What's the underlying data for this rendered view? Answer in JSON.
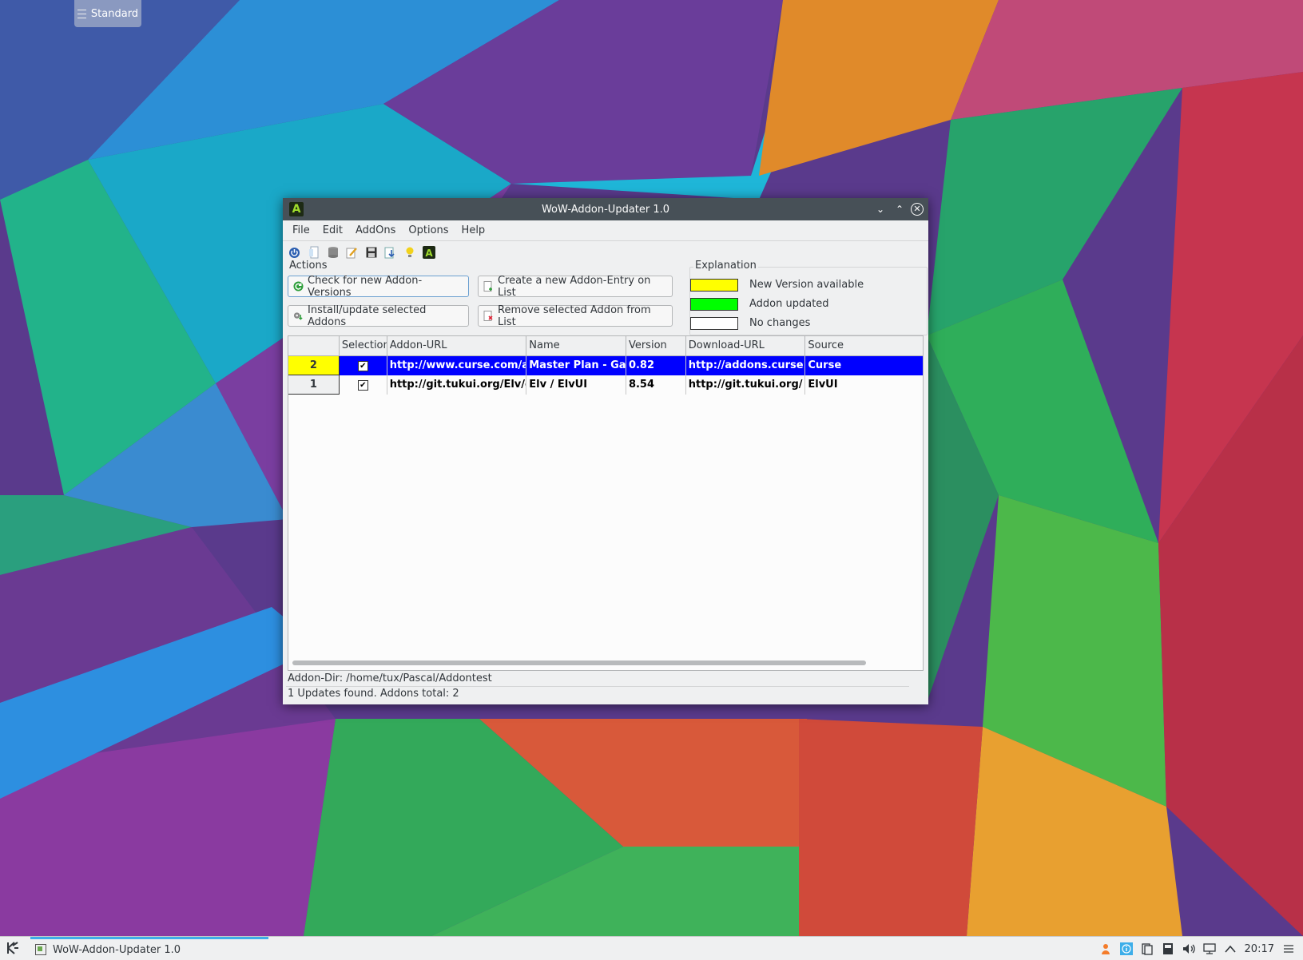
{
  "desktop": {
    "panel_label": "Standard"
  },
  "window": {
    "title": "WoW-Addon-Updater 1.0",
    "app_icon_letter": "A",
    "controls": {
      "minimize": "⌄",
      "maximize": "⌃",
      "close": "✕"
    }
  },
  "menu": [
    "File",
    "Edit",
    "AddOns",
    "Options",
    "Help"
  ],
  "toolbar": {
    "icons": [
      "power-icon",
      "page-icon",
      "database-icon",
      "edit-icon",
      "save-icon",
      "import-icon",
      "lightbulb-icon",
      "addon-logo-icon"
    ]
  },
  "actions": {
    "title": "Actions",
    "check": "Check for new Addon-Versions",
    "create": "Create a new Addon-Entry on List",
    "install": "Install/update selected Addons",
    "remove": "Remove selected Addon from List"
  },
  "explanation": {
    "title": "Explanation",
    "items": [
      {
        "label": "New Version available",
        "color": "#ffff00"
      },
      {
        "label": "Addon updated",
        "color": "#00ff00"
      },
      {
        "label": "No changes",
        "color": "#ffffff"
      }
    ]
  },
  "table": {
    "columns": [
      "",
      "Selection",
      "Addon-URL",
      "Name",
      "Version",
      "Download-URL",
      "Source"
    ],
    "rows": [
      {
        "num": "2",
        "selected": "✔",
        "addon_url": "http://www.curse.com/addons/wow/master-plan",
        "name": "Master Plan - Garrison",
        "version": "0.82",
        "download_url": "http://addons.curse.cursecdn.com",
        "source": "Curse"
      },
      {
        "num": "1",
        "selected": "✔",
        "addon_url": "http://git.tukui.org/Elv/elvui",
        "name": "Elv / ElvUI",
        "version": "8.54",
        "download_url": "http://git.tukui.org/",
        "source": "ElvUI"
      }
    ]
  },
  "status": {
    "addon_dir": "Addon-Dir: /home/tux/Pascal/Addontest",
    "summary": "1 Updates found. Addons total: 2"
  },
  "taskbar": {
    "task_label": "WoW-Addon-Updater 1.0",
    "clock": "20:17"
  },
  "colors": {
    "selection_blue": "#0000ff",
    "new_version_yellow": "#ffff00",
    "updated_green": "#00ff00",
    "accent": "#3daee9"
  }
}
